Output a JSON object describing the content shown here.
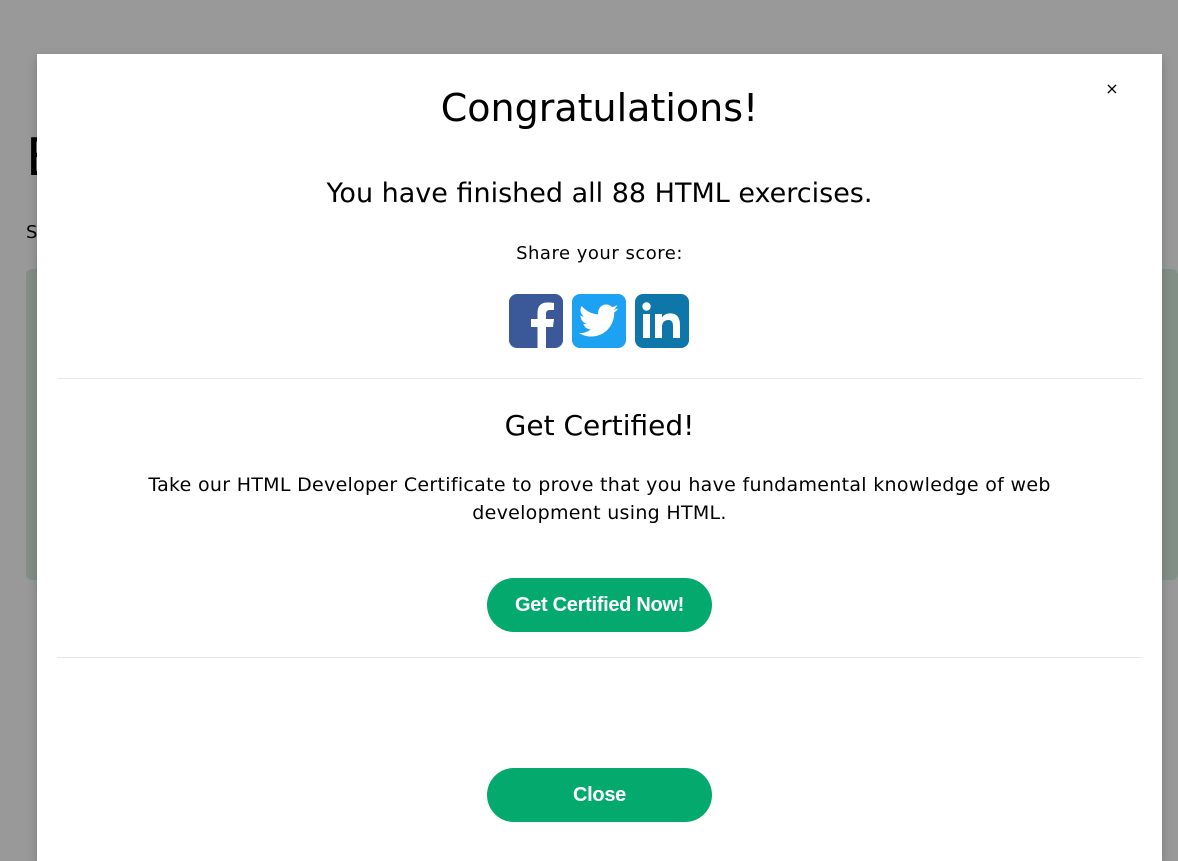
{
  "background": {
    "heading_fragment": "E",
    "sub_fragment": "S"
  },
  "modal": {
    "close_icon_glyph": "×",
    "title": "Congratulations!",
    "finished_text": "You have finished all 88 HTML exercises.",
    "share_label": "Share your score:",
    "social": [
      {
        "name": "facebook",
        "icon": "facebook-icon",
        "color": "#3b5998"
      },
      {
        "name": "twitter",
        "icon": "twitter-icon",
        "color": "#1da1f2"
      },
      {
        "name": "linkedin",
        "icon": "linkedin-icon",
        "color": "#0e76a8"
      }
    ],
    "cert_title": "Get Certified!",
    "cert_description": "Take our HTML Developer Certificate to prove that you have fundamental knowledge of web development using HTML.",
    "cert_button_label": "Get Certified Now!",
    "close_button_label": "Close"
  },
  "colors": {
    "accent": "#04aa6d",
    "overlay": "rgba(0,0,0,0.4)"
  }
}
